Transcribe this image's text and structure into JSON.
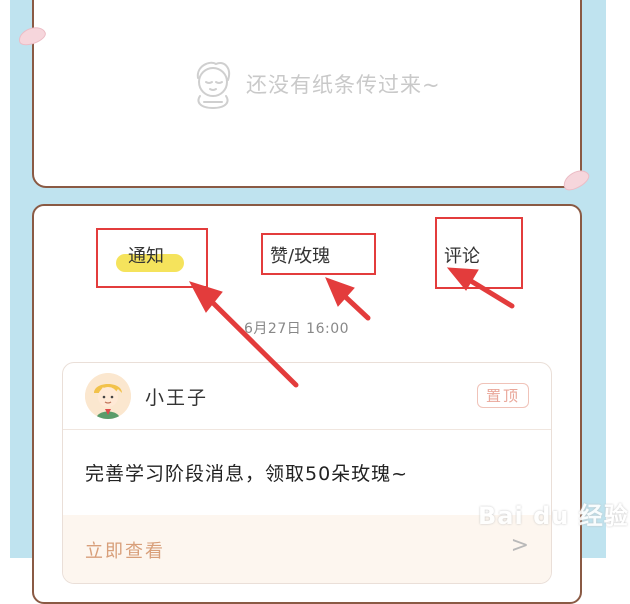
{
  "empty_state": {
    "message": "还没有纸条传过来~",
    "illustration": "sleepy-kid-icon"
  },
  "tabs": [
    {
      "label": "通知",
      "active": true
    },
    {
      "label": "赞/玫瑰",
      "active": false
    },
    {
      "label": "评论",
      "active": false
    }
  ],
  "date": "6月27日  16:00",
  "message": {
    "sender": "小王子",
    "pin_label": "置顶",
    "body": "完善学习阶段消息，领取50朵玫瑰~",
    "action_label": "立即查看"
  },
  "watermark": "Bai du 经验",
  "colors": {
    "background": "#bfe3ef",
    "card_border": "#8a5a44",
    "annotation_red": "#e33c3c",
    "tab_highlight": "#f3de3f",
    "action_text": "#d89f7a"
  }
}
